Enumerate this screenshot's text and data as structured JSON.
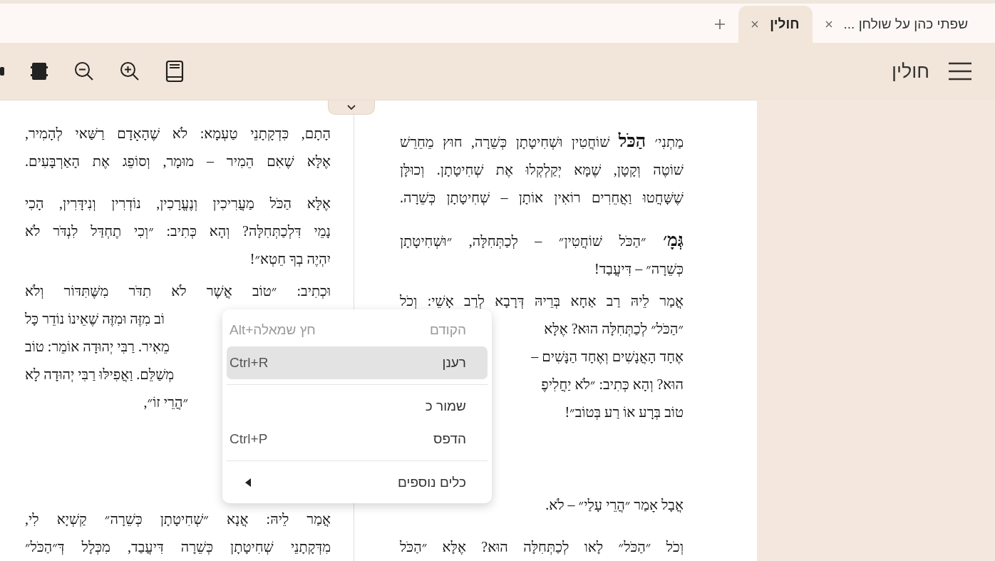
{
  "tabs": [
    {
      "label": "שפתי כהן על שולחן ...",
      "selected": false
    },
    {
      "label": "חולין",
      "selected": true
    }
  ],
  "toolbar": {
    "title": "חולין"
  },
  "columns": [
    {
      "sections": [
        [
          {
            "lines": [
              {
                "text": "מַתְנִי׳ **הַכֹּל** שׁוֹחֲטִין וּשְׁחִיטָתָן כְּשֵׁרָה, חוּץ מֵחֵרֵשׁ",
                "kind": "full"
              },
              {
                "text": "שׁוֹטֶה וְקָטָן, שֶׁמָּא יְקַלְקְלוּ אֶת שְׁחִיטָתָן. וְכוּלָּן",
                "kind": "full"
              },
              {
                "text": "שֶׁשָּׁחֲטוּ וַאֲחֵרִים רוֹאִין אוֹתָן – שְׁחִיטָתָן כְּשֵׁרָה.",
                "kind": "full"
              }
            ]
          },
          {
            "lines": [
              {
                "text": "**גְּמָ׳** ״הַכֹּל שׁוֹחֲטִין״ – לְכַתְּחִלָּה, ״וּשְׁחִיטָתָן",
                "kind": "full"
              },
              {
                "text": "כְּשֵׁרָה״ – דִּיעֲבַד!",
                "kind": "last"
              }
            ]
          },
          {
            "lines": [
              {
                "text": "אֲמַר לֵיהּ רַב אַחָא בְּרֵיהּ דְּרָבָא לְרַב אָשֵׁי: וְכֹל",
                "kind": "full"
              },
              {
                "text": "״הַכֹּל״ לְכַתְּחִלָּה הוּא? אֶלָּא",
                "kind": "head"
              },
              {
                "text": "אֶחָד הָאֲנָשִׁים וְאֶחָד הַנָּשִׁים –",
                "kind": "head"
              },
              {
                "text": "הוּא? וְהָא כְּתִיב: ״לֹא יַחֲלִיפֶ",
                "kind": "head"
              },
              {
                "text": "טוֹב בְּרָע אוֹ רַע בְּטוֹב״!",
                "kind": "last"
              }
            ]
          }
        ],
        [
          {
            "lines": [
              {
                "text": "אֲבָל אָמַר ״הֲרֵי עָלַי״ – לֹא.",
                "kind": "last"
              }
            ]
          },
          {
            "lines": [
              {
                "text": "וְכֹל ״הַכֹּל״ לָאו לְכַתְּחִלָּה הוּא? אֶלָּא ״הַכֹּל",
                "kind": "full"
              }
            ]
          }
        ]
      ]
    },
    {
      "sections": [
        [
          {
            "lines": [
              {
                "text": "הָתָם, כִּדְקָתָנֵי טַעְמָא: לֹא שֶׁהָאָדָם רַשַּׁאי לְהָמִיר,",
                "kind": "full"
              },
              {
                "text": "אֶלָּא שֶׁאִם הֵמִיר – מוּמָר, וְסוֹפֵג אֶת הָאַרְבָּעִים.",
                "kind": "full"
              }
            ]
          },
          {
            "lines": [
              {
                "text": "אֶלָּא הַכֹּל מַעֲרִיכִין וְנֶעֱרָכִין, נוֹדְרִין וְנִידָּרִין, הָכִי",
                "kind": "full"
              },
              {
                "text": "נָמֵי דִּלְכַתְּחִלָּה? וְהָא כְּתִיב: ״וְכִי תֶחְדַּל לִנְדֹּר לֹא",
                "kind": "full"
              },
              {
                "text": "יִהְיֶה בְךָ חֵטְא״!",
                "kind": "last"
              }
            ]
          },
          {
            "lines": [
              {
                "text": "וּכְתִיב: ״טוֹב אֲשֶׁר לֹא תִדֹּר מִשֶּׁתִּדּוֹר וְלֹא",
                "kind": "full"
              },
              {
                "text": "וֹב מִזֶּה וּמִזֶּה שֶׁאֵינוֹ נוֹדֵר כָּל",
                "kind": "tail"
              },
              {
                "text": "מֵאִיר. רַבִּי יְהוּדָה אוֹמֵר: טוֹב",
                "kind": "tail"
              },
              {
                "text": "מְשַׁלֵּם. וַאֲפִילּוּ רַבִּי יְהוּדָה לָא",
                "kind": "tail"
              },
              {
                "text": "״הֲרֵי זוֹ״,",
                "kind": "tail_last"
              }
            ]
          }
        ],
        [
          {
            "lines": [
              {
                "text": "אֲמַר לֵיהּ: אֲנָא ״שְׁחִיטָתָן כְּשֵׁרָה״ קַשְׁיָא לִי,",
                "kind": "full"
              },
              {
                "text": "מִדְּקָתָנֵי שְׁחִיטָתָן כְּשֵׁרָה דִּיעֲבַד, מִכְּלָל דְּ״הַכֹּל״",
                "kind": "full"
              }
            ]
          }
        ]
      ]
    }
  ],
  "menu": [
    {
      "kind": "item",
      "label": "הקודם",
      "shortcut": "Alt+חץ שמאלה",
      "disabled": true,
      "selected": false
    },
    {
      "kind": "item",
      "label": "רענן",
      "shortcut": "Ctrl+R",
      "disabled": false,
      "selected": true
    },
    {
      "kind": "separator"
    },
    {
      "kind": "item",
      "label": "שמור כ",
      "disabled": false,
      "selected": false
    },
    {
      "kind": "item",
      "label": "הדפס",
      "shortcut": "Ctrl+P",
      "disabled": false,
      "selected": false
    },
    {
      "kind": "separator"
    },
    {
      "kind": "submenu",
      "label": "כלים נוספים",
      "disabled": false,
      "selected": false
    }
  ]
}
